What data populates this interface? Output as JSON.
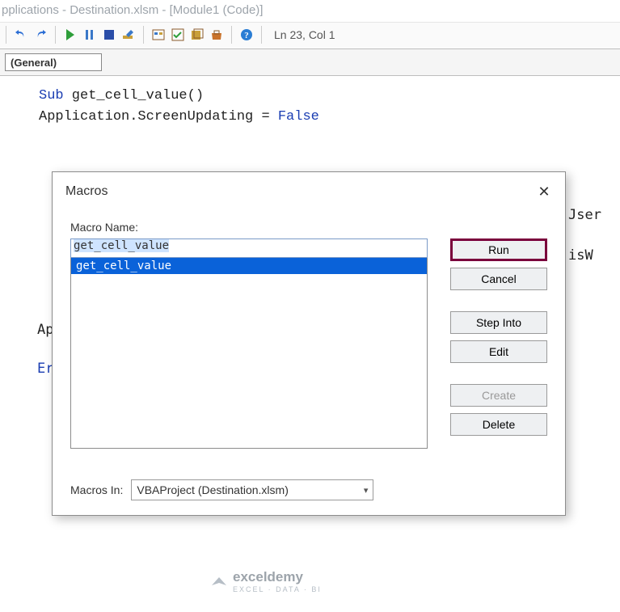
{
  "window": {
    "title": "pplications - Destination.xlsm - [Module1 (Code)]"
  },
  "toolbar": {
    "status": "Ln 23, Col 1",
    "icons": {
      "undo": "undo-icon",
      "redo": "redo-icon",
      "run": "play-icon",
      "pause": "pause-icon",
      "stop": "stop-icon",
      "design": "design-icon",
      "project": "project-icon",
      "props": "properties-icon",
      "browser": "object-browser-icon",
      "toolbox": "toolbox-icon",
      "tab": "tab-order-icon",
      "help": "help-icon"
    }
  },
  "scope": {
    "value": "(General)"
  },
  "code": {
    "l1a": "Sub",
    "l1b": " get_cell_value()",
    "l2": "",
    "l3a": "Application.ScreenUpdating = ",
    "l3b": "False",
    "bg_user": "Jser",
    "bg_iswo": "isW",
    "bg_ap": "Ap",
    "bg_er": "Er"
  },
  "dialog": {
    "title": "Macros",
    "name_label": "Macro Name:",
    "name_input": "get_cell_value",
    "list": [
      "get_cell_value"
    ],
    "buttons": {
      "run": "Run",
      "cancel": "Cancel",
      "stepinto": "Step Into",
      "edit": "Edit",
      "create": "Create",
      "delete": "Delete"
    },
    "macros_in_label": "Macros In:",
    "macros_in_value": "VBAProject (Destination.xlsm)"
  },
  "watermark": {
    "brand": "exceldemy",
    "sub": "EXCEL · DATA · BI"
  }
}
